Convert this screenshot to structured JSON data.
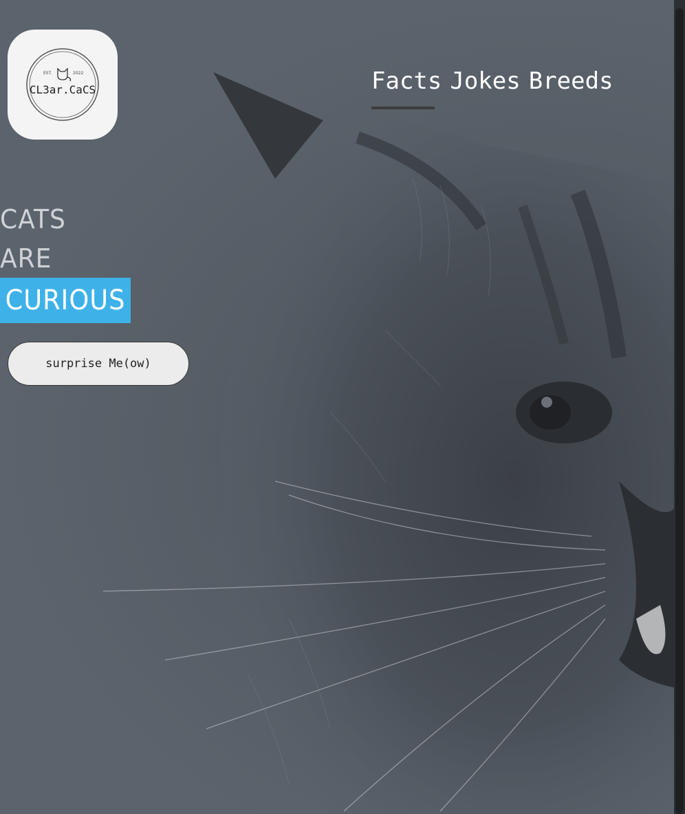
{
  "logo": {
    "est_label": "EST.",
    "year": "2022",
    "brand": "CL3ar.CaCS"
  },
  "nav": {
    "items": [
      {
        "label": "Facts"
      },
      {
        "label": "Jokes"
      },
      {
        "label": "Breeds"
      }
    ],
    "active_index": 0
  },
  "hero": {
    "line1": "CATS",
    "line2": "ARE",
    "highlight": "CURIOUS"
  },
  "cta": {
    "label": "surprise Me(ow)"
  },
  "colors": {
    "background": "#5b636c",
    "accent": "#3eb2e8",
    "nav_text": "#ffffff",
    "button_bg": "#ececec"
  },
  "icons": {
    "logo_mark": "cat-icon",
    "hero_art": "cat-photo"
  }
}
